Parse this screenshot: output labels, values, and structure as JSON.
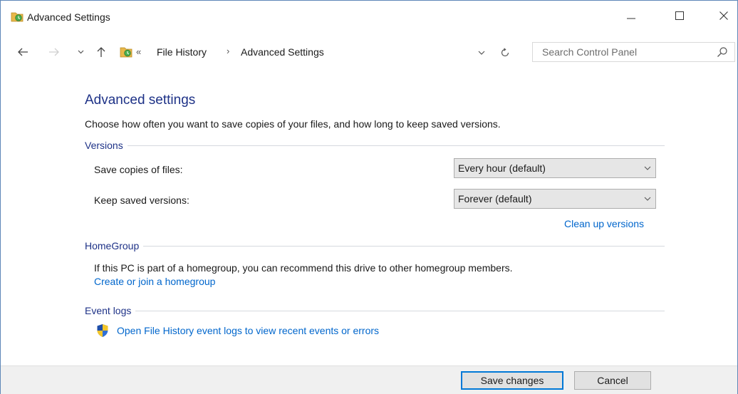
{
  "window": {
    "title": "Advanced Settings",
    "controls": {
      "minimize_icon": "minimize-icon",
      "maximize_icon": "maximize-icon",
      "close_icon": "close-icon"
    }
  },
  "navigation": {
    "back_icon": "arrow-left-icon",
    "forward_icon": "arrow-right-icon",
    "recent_icon": "chevron-down-icon",
    "up_icon": "arrow-up-icon",
    "address": {
      "overflow": "«",
      "crumbs": [
        "File History",
        "Advanced Settings"
      ],
      "separator": "›"
    },
    "refresh_icon": "refresh-icon",
    "search": {
      "placeholder": "Search Control Panel",
      "value": ""
    }
  },
  "main": {
    "title": "Advanced settings",
    "intro": "Choose how often you want to save copies of your files, and how long to keep saved versions.",
    "versions": {
      "heading": "Versions",
      "save_copies_label": "Save copies of files:",
      "save_copies_value": "Every hour (default)",
      "keep_versions_label": "Keep saved versions:",
      "keep_versions_value": "Forever (default)",
      "cleanup_link": "Clean up versions"
    },
    "homegroup": {
      "heading": "HomeGroup",
      "text": "If this PC is part of a homegroup, you can recommend this drive to other homegroup members.",
      "link": "Create or join a homegroup"
    },
    "event_logs": {
      "heading": "Event logs",
      "link": "Open File History event logs to view recent events or errors"
    }
  },
  "footer": {
    "save_label": "Save changes",
    "cancel_label": "Cancel"
  },
  "colors": {
    "heading_blue": "#1e3287",
    "link_blue": "#0066cc",
    "focus_blue": "#0078d7"
  }
}
